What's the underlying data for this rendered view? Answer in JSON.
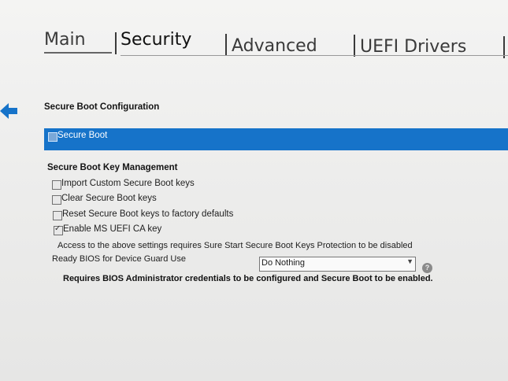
{
  "tabs": [
    {
      "label": "Main"
    },
    {
      "label": "Security"
    },
    {
      "label": "Advanced"
    },
    {
      "label": "UEFI Drivers"
    }
  ],
  "active_tab": "Security",
  "page": {
    "section_title": "Secure Boot Configuration",
    "secure_boot": {
      "label": "Secure Boot",
      "checked": false,
      "selected": true
    },
    "key_management": {
      "title": "Secure Boot Key Management",
      "options": [
        {
          "label": "Import Custom Secure Boot keys",
          "checked": false
        },
        {
          "label": "Clear Secure Boot keys",
          "checked": false
        },
        {
          "label": "Reset Secure Boot keys to factory defaults",
          "checked": false
        },
        {
          "label": "Enable MS UEFI CA key",
          "checked": true
        }
      ]
    },
    "access_note": "Access to the above settings requires Sure Start Secure Boot Keys Protection to be disabled",
    "device_guard": {
      "label": "Ready BIOS for Device Guard Use",
      "value": "Do Nothing"
    },
    "requirement_note": "Requires BIOS Administrator credentials to be configured and Secure Boot to be enabled."
  },
  "icons": {
    "back": "back-arrow-icon",
    "help": "help-icon",
    "dropdown": "chevron-down-icon"
  },
  "colors": {
    "selection": "#1673c9",
    "background": "#eeeeed",
    "text": "#1b1b1b"
  }
}
